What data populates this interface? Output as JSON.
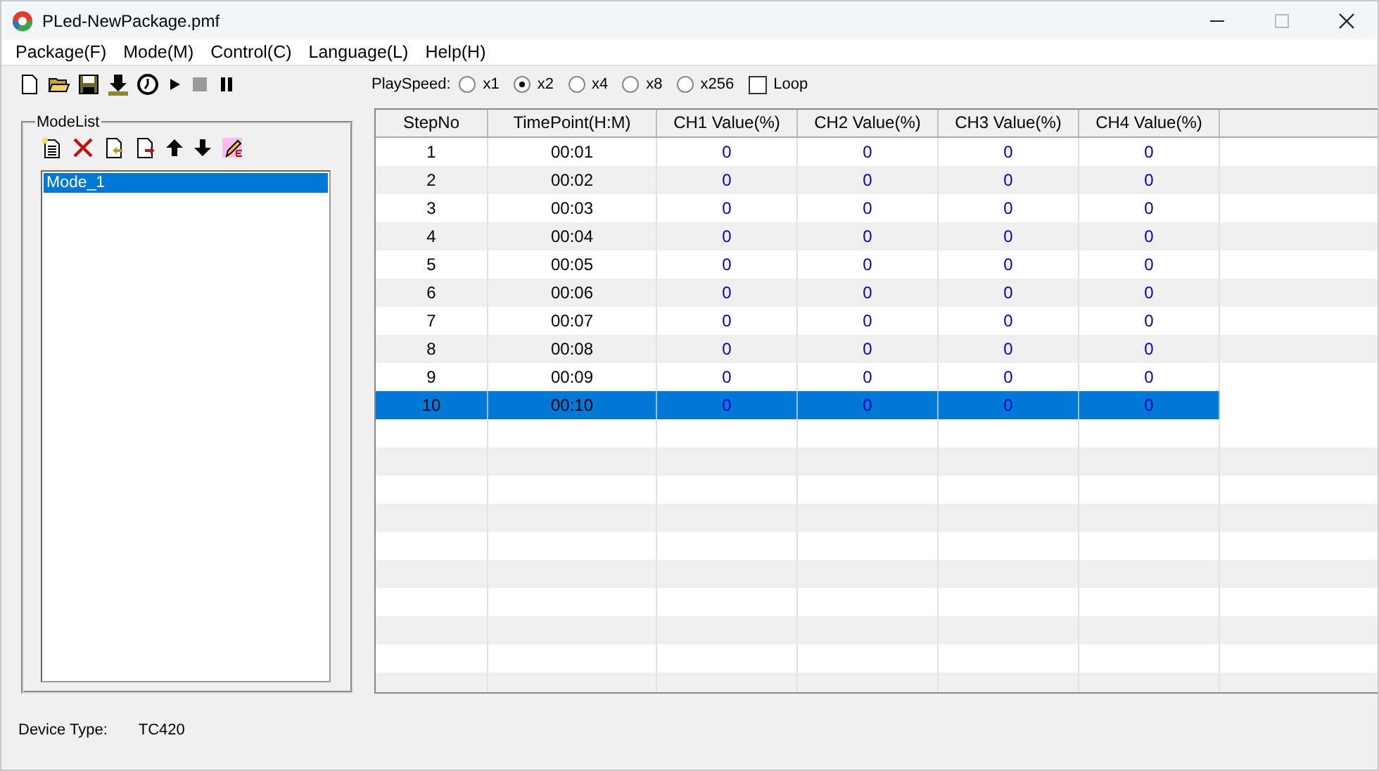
{
  "window": {
    "title": "PLed-NewPackage.pmf"
  },
  "menu": [
    "Package(F)",
    "Mode(M)",
    "Control(C)",
    "Language(L)",
    "Help(H)"
  ],
  "play_speed": {
    "label": "PlaySpeed:",
    "options": [
      {
        "label": "x1",
        "selected": false
      },
      {
        "label": "x2",
        "selected": true
      },
      {
        "label": "x4",
        "selected": false
      },
      {
        "label": "x8",
        "selected": false
      },
      {
        "label": "x256",
        "selected": false
      }
    ],
    "loop": {
      "label": "Loop",
      "checked": false
    }
  },
  "mode_list": {
    "title": "ModeList",
    "items": [
      {
        "label": "Mode_1",
        "selected": true
      }
    ]
  },
  "table": {
    "columns": [
      "StepNo",
      "TimePoint(H:M)",
      "CH1 Value(%)",
      "CH2 Value(%)",
      "CH3 Value(%)",
      "CH4 Value(%)"
    ],
    "rows": [
      {
        "cells": [
          "1",
          "00:01",
          "0",
          "0",
          "0",
          "0"
        ],
        "selected": false
      },
      {
        "cells": [
          "2",
          "00:02",
          "0",
          "0",
          "0",
          "0"
        ],
        "selected": false
      },
      {
        "cells": [
          "3",
          "00:03",
          "0",
          "0",
          "0",
          "0"
        ],
        "selected": false
      },
      {
        "cells": [
          "4",
          "00:04",
          "0",
          "0",
          "0",
          "0"
        ],
        "selected": false
      },
      {
        "cells": [
          "5",
          "00:05",
          "0",
          "0",
          "0",
          "0"
        ],
        "selected": false
      },
      {
        "cells": [
          "6",
          "00:06",
          "0",
          "0",
          "0",
          "0"
        ],
        "selected": false
      },
      {
        "cells": [
          "7",
          "00:07",
          "0",
          "0",
          "0",
          "0"
        ],
        "selected": false
      },
      {
        "cells": [
          "8",
          "00:08",
          "0",
          "0",
          "0",
          "0"
        ],
        "selected": false
      },
      {
        "cells": [
          "9",
          "00:09",
          "0",
          "0",
          "0",
          "0"
        ],
        "selected": false
      },
      {
        "cells": [
          "10",
          "00:10",
          "0",
          "0",
          "0",
          "0"
        ],
        "selected": true
      }
    ]
  },
  "status_bar": {
    "label": "Device Type:",
    "value": "TC420"
  }
}
